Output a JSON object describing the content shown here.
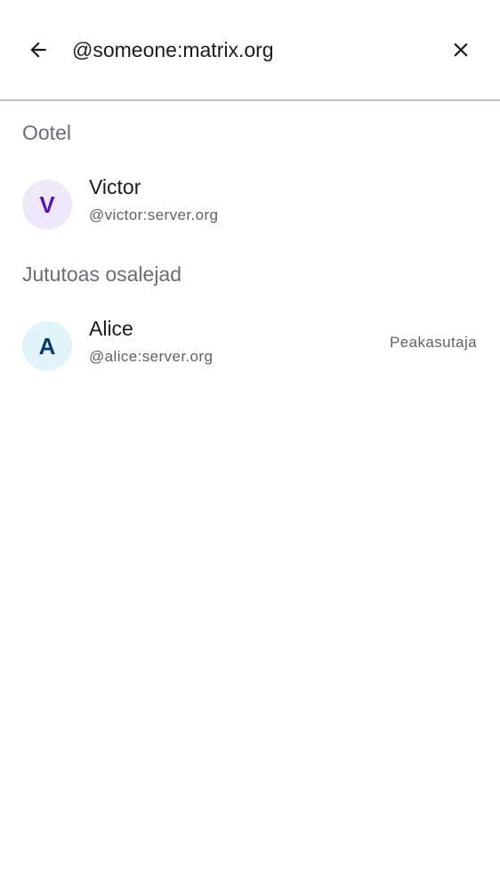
{
  "search": {
    "value": "@someone:matrix.org",
    "back_icon": "arrow-back-icon",
    "clear_icon": "close-icon"
  },
  "sections": [
    {
      "title": "Ootel",
      "members": [
        {
          "initial": "V",
          "name": "Victor",
          "user_id": "@victor:server.org",
          "role": "",
          "avatar_bg": "#efe8fb",
          "avatar_fg": "#5a15b0"
        }
      ]
    },
    {
      "title": "Jututoas osalejad",
      "members": [
        {
          "initial": "A",
          "name": "Alice",
          "user_id": "@alice:server.org",
          "role": "Peakasutaja",
          "avatar_bg": "#e1f4f9",
          "avatar_fg": "#0b3b6b"
        }
      ]
    }
  ]
}
